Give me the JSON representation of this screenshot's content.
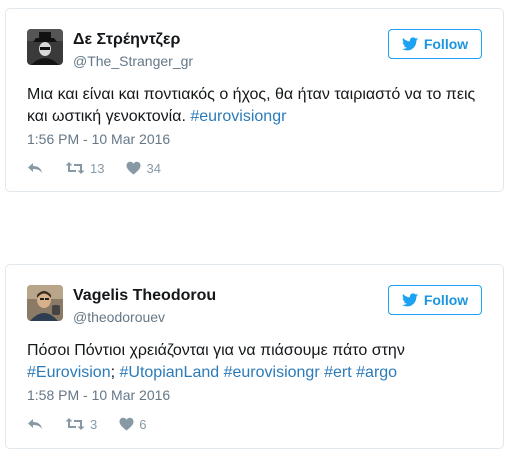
{
  "follow_label": "Follow",
  "colors": {
    "accent": "#1da1f2",
    "link": "#2b7bb9",
    "muted": "#657786",
    "icon": "#8899a6"
  },
  "tweets": [
    {
      "display_name": "Δε Στρέηντζερ",
      "handle": "@The_Stranger_gr",
      "text_parts": [
        "Μια και είναι και ποντιακός ο ήχος, θα ήταν ταιριαστό να το πεις και ωστική γενοκτονία. ",
        "#eurovisiongr"
      ],
      "timestamp": "1:56 PM - 10 Mar 2016",
      "retweets": "13",
      "likes": "34",
      "avatar_icon": "masked-figure-avatar"
    },
    {
      "display_name": "Vagelis Theodorou",
      "handle": "@theodorouev",
      "text_parts": [
        "Πόσοι Πόντιοι χρειάζονται για να πιάσουμε πάτο στην ",
        "#Eurovision",
        "; ",
        "#UtopianLand",
        " ",
        "#eurovisiongr",
        " ",
        "#ert",
        " ",
        "#argo"
      ],
      "timestamp": "1:58 PM - 10 Mar 2016",
      "retweets": "3",
      "likes": "6",
      "avatar_icon": "person-photo-avatar"
    }
  ]
}
